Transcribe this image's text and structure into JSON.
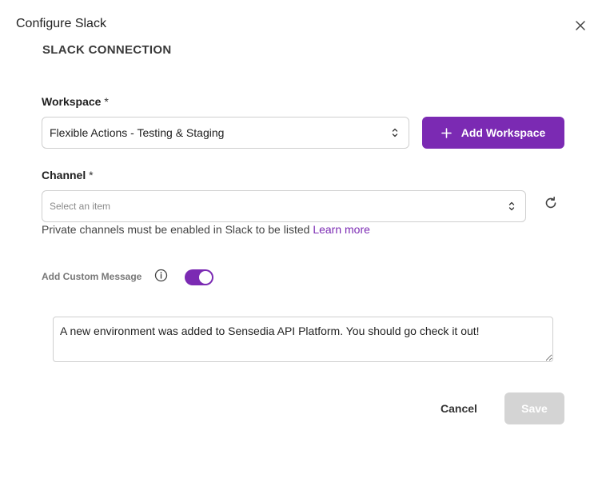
{
  "dialog": {
    "title": "Configure Slack",
    "close_icon": "close-icon"
  },
  "section": {
    "title": "SLACK CONNECTION"
  },
  "workspace": {
    "label": "Workspace",
    "required_mark": "*",
    "selected_value": "Flexible Actions - Testing & Staging",
    "add_button_label": "Add Workspace",
    "add_icon": "plus-icon"
  },
  "channel": {
    "label": "Channel",
    "required_mark": "*",
    "placeholder": "Select an item",
    "refresh_icon": "refresh-icon",
    "helper_text": "Private channels must be enabled in Slack to be listed",
    "learn_more_label": "Learn more"
  },
  "custom_message": {
    "label": "Add Custom Message",
    "info_icon": "info-icon",
    "enabled": true,
    "value": "A new environment was added to Sensedia API Platform. You should go check it out!"
  },
  "footer": {
    "cancel_label": "Cancel",
    "save_label": "Save"
  },
  "colors": {
    "accent": "#7b2ab3",
    "disabled": "#d4d4d4"
  }
}
